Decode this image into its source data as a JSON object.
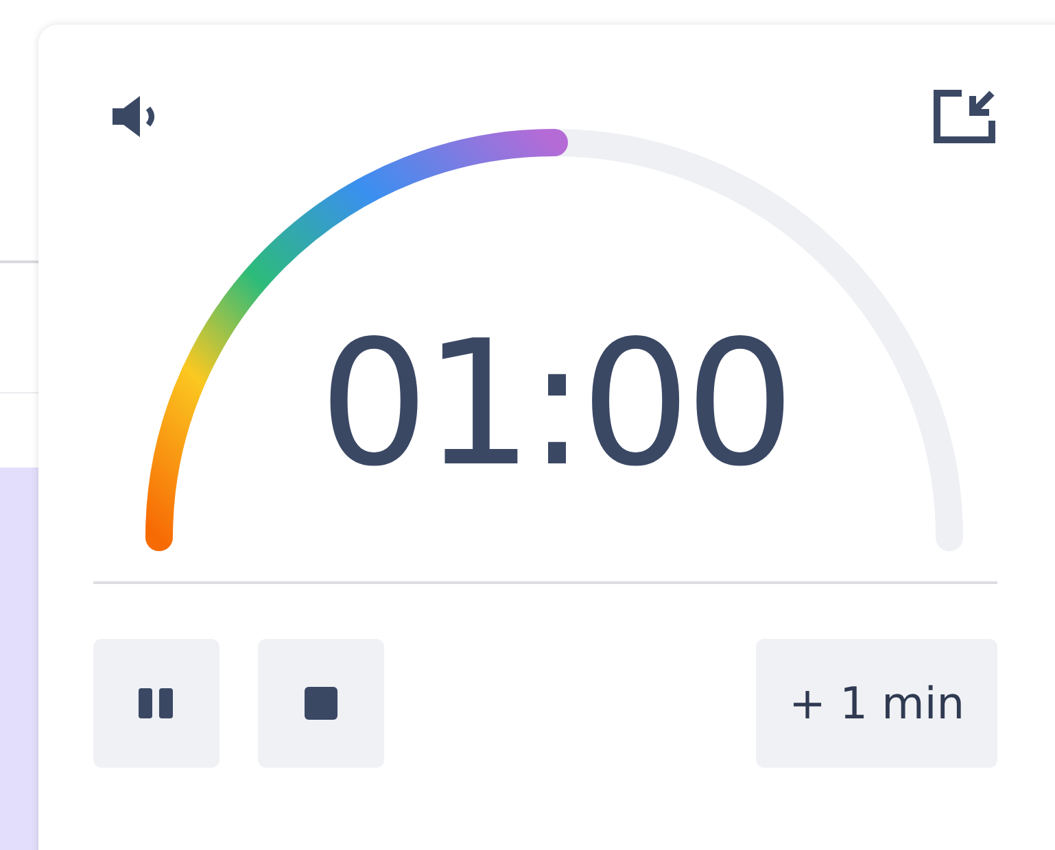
{
  "timer": {
    "sound_on": true,
    "progress": {
      "level": 0.5
    },
    "time": "01:00"
  },
  "controls": [
    {
      "kind": "pause"
    },
    {
      "kind": "stop"
    },
    {
      "kind": "add",
      "label": "+ 1 min"
    }
  ]
}
